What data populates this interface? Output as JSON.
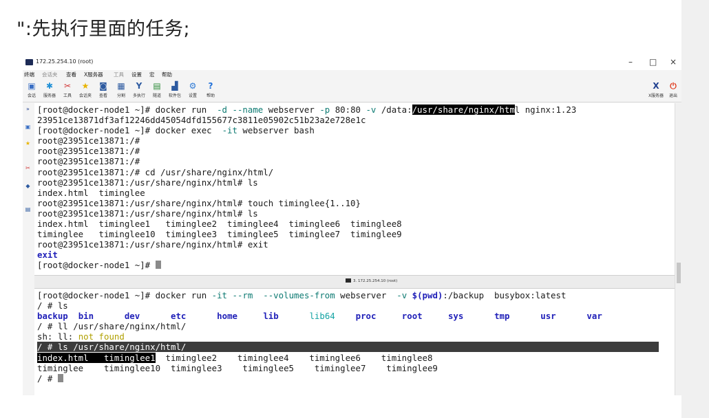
{
  "heading": "\":先执行里面的任务;",
  "window": {
    "title": "172.25.254.10 (root)",
    "controls": {
      "minimize": "–",
      "maximize": "□",
      "close": "×"
    }
  },
  "menu": [
    "终端",
    "会话夹",
    "查看",
    "X服务器",
    "工具",
    "设置",
    "宏",
    "帮助"
  ],
  "toolbar": [
    {
      "label": "会话",
      "icon": "monitor-icon",
      "color": "#3a6fc4",
      "glyph": "▣"
    },
    {
      "label": "服务器",
      "icon": "server-icon",
      "color": "#1f8fd6",
      "glyph": "✱"
    },
    {
      "label": "工具",
      "icon": "tools-icon",
      "color": "#d23a3a",
      "glyph": "✂"
    },
    {
      "label": "会话夹",
      "icon": "star-icon",
      "color": "#e8b400",
      "glyph": "★"
    },
    {
      "label": "查看",
      "icon": "view-icon",
      "color": "#2d5aa0",
      "glyph": "◙"
    },
    {
      "label": "分割",
      "icon": "split-icon",
      "color": "#2d5aa0",
      "glyph": "▦"
    },
    {
      "label": "多执行",
      "icon": "multiexec-icon",
      "color": "#2d5aa0",
      "glyph": "Y"
    },
    {
      "label": "隧道",
      "icon": "tunnel-icon",
      "color": "#2e8b3a",
      "glyph": "▤"
    },
    {
      "label": "软件包",
      "icon": "package-icon",
      "color": "#2d5aa0",
      "glyph": "▟"
    },
    {
      "label": "设置",
      "icon": "gear-icon",
      "color": "#2d7ad6",
      "glyph": "⚙"
    },
    {
      "label": "帮助",
      "icon": "help-icon",
      "color": "#1e6fd9",
      "glyph": "?"
    }
  ],
  "toolbar_right": [
    {
      "label": "X服务器",
      "icon": "x-server-icon",
      "color": "#1f3f8f",
      "glyph": "X"
    },
    {
      "label": "退出",
      "icon": "power-icon",
      "color": "#e03a1e",
      "glyph": "⏻"
    }
  ],
  "split_label": "3. 172.25.254.10 (root)",
  "terminal1": {
    "lines": [
      [
        {
          "t": "[root@docker-node1 ~]# docker run  "
        },
        {
          "t": "-d",
          "c": "flag"
        },
        {
          "t": " "
        },
        {
          "t": "--name",
          "c": "flag"
        },
        {
          "t": " webserver "
        },
        {
          "t": "-p",
          "c": "flag"
        },
        {
          "t": " 80:80 "
        },
        {
          "t": "-v",
          "c": "flag"
        },
        {
          "t": " /data:"
        },
        {
          "t": "/usr/share/nginx/htm",
          "c": "sel"
        },
        {
          "t": "l nginx:1.23"
        }
      ],
      [
        {
          "t": "23951ce13871df3af12246dd45054dfd155677c3811e05902c51b23a2e728e1c"
        }
      ],
      [
        {
          "t": "[root@docker-node1 ~]# docker exec  "
        },
        {
          "t": "-it",
          "c": "flag"
        },
        {
          "t": " webserver bash"
        }
      ],
      [
        {
          "t": "root@23951ce13871:/#"
        }
      ],
      [
        {
          "t": "root@23951ce13871:/#"
        }
      ],
      [
        {
          "t": "root@23951ce13871:/#"
        }
      ],
      [
        {
          "t": "root@23951ce13871:/# cd /usr/share/nginx/html/"
        }
      ],
      [
        {
          "t": "root@23951ce13871:/usr/share/nginx/html# ls"
        }
      ],
      [
        {
          "t": "index.html  timinglee"
        }
      ],
      [
        {
          "t": "root@23951ce13871:/usr/share/nginx/html# touch timinglee{1..10}"
        }
      ],
      [
        {
          "t": "root@23951ce13871:/usr/share/nginx/html# ls"
        }
      ],
      [
        {
          "t": "index.html  timinglee1   timinglee2  timinglee4  timinglee6  timinglee8"
        }
      ],
      [
        {
          "t": "timinglee   timinglee10  timinglee3  timinglee5  timinglee7  timinglee9"
        }
      ],
      [
        {
          "t": "root@23951ce13871:/usr/share/nginx/html# exit"
        }
      ],
      [
        {
          "t": "exit",
          "c": "exitw"
        }
      ],
      [
        {
          "t": "[root@docker-node1 ~]# "
        },
        {
          "t": "",
          "c": "cursor"
        }
      ]
    ]
  },
  "terminal2": {
    "lines": [
      [
        {
          "t": "[root@docker-node1 ~]# docker run "
        },
        {
          "t": "-it",
          "c": "flag"
        },
        {
          "t": " "
        },
        {
          "t": "--rm",
          "c": "flag"
        },
        {
          "t": "  "
        },
        {
          "t": "--volumes-from",
          "c": "flag"
        },
        {
          "t": " webserver  "
        },
        {
          "t": "-v",
          "c": "flag"
        },
        {
          "t": " "
        },
        {
          "t": "$(pwd)",
          "c": "name"
        },
        {
          "t": ":/backup  busybox:latest"
        }
      ],
      [
        {
          "t": "/ # ls"
        }
      ],
      [
        {
          "t": "backup",
          "c": "dir-b"
        },
        {
          "t": "  "
        },
        {
          "t": "bin",
          "c": "dir-b"
        },
        {
          "t": "      "
        },
        {
          "t": "dev",
          "c": "dir-b"
        },
        {
          "t": "      "
        },
        {
          "t": "etc",
          "c": "dir-b"
        },
        {
          "t": "      "
        },
        {
          "t": "home",
          "c": "dir-b"
        },
        {
          "t": "     "
        },
        {
          "t": "lib",
          "c": "dir-b"
        },
        {
          "t": "      "
        },
        {
          "t": "lib64",
          "c": "dir-c"
        },
        {
          "t": "    "
        },
        {
          "t": "proc",
          "c": "dir-b"
        },
        {
          "t": "     "
        },
        {
          "t": "root",
          "c": "dir-b"
        },
        {
          "t": "     "
        },
        {
          "t": "sys",
          "c": "dir-b"
        },
        {
          "t": "      "
        },
        {
          "t": "tmp",
          "c": "dir-b"
        },
        {
          "t": "      "
        },
        {
          "t": "usr",
          "c": "dir-b"
        },
        {
          "t": "      "
        },
        {
          "t": "var",
          "c": "dir-b"
        }
      ],
      [
        {
          "t": "/ # ll /usr/share/nginx/html/"
        }
      ],
      [
        {
          "t": "sh: ll: "
        },
        {
          "t": "not found",
          "c": "warn"
        }
      ],
      [
        {
          "t": "/ # ls /usr/share/nginx/html/                                                                                            ",
          "c": "rowsel"
        }
      ],
      [
        {
          "t": "index.html   timinglee1",
          "c": "sel"
        },
        {
          "t": "  timinglee2    timinglee4    timinglee6    timinglee8"
        }
      ],
      [
        {
          "t": "timinglee    timinglee10  timinglee3    timinglee5    timinglee7    timinglee9"
        }
      ],
      [
        {
          "t": "/ # "
        },
        {
          "t": "",
          "c": "cursor"
        }
      ]
    ]
  }
}
